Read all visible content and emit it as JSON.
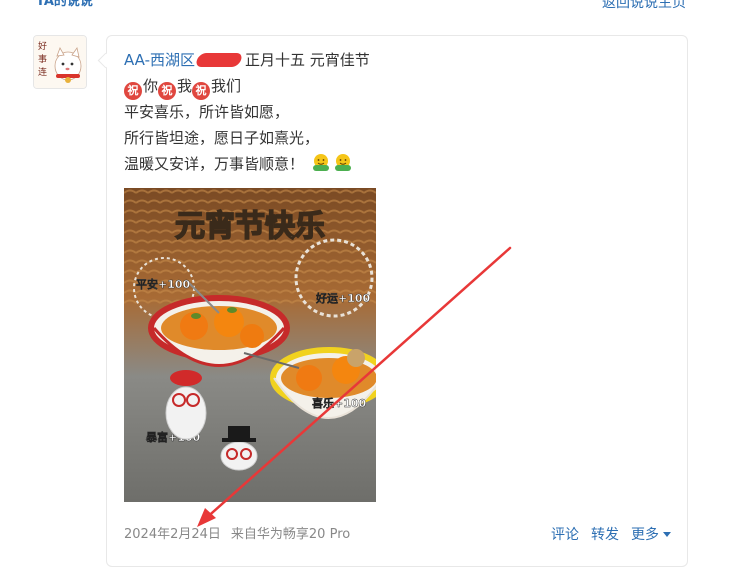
{
  "page": {
    "section_title": "TA的说说",
    "back_link": "返回说说主页"
  },
  "post": {
    "author": "AA-西湖区",
    "header_rest": "正月十五 元宵佳节",
    "greeting_badge": "祝",
    "greeting_words": [
      "你",
      "我",
      "我们"
    ],
    "lines": [
      "平安喜乐，所许皆如愿，",
      "所行皆坦途，愿日子如熹光，",
      "温暖又安详，万事皆顺意！"
    ],
    "image": {
      "title": "元宵节快乐",
      "labels": [
        "平安+100",
        "好运+100",
        "喜乐+100",
        "暴富+100"
      ]
    },
    "date": "2024年2月24日",
    "source": "来自华为畅享20 Pro",
    "actions": {
      "comment": "评论",
      "forward": "转发",
      "more": "更多"
    }
  },
  "colors": {
    "link": "#2d6fb3",
    "badge": "#e0473f",
    "annotation": "#e83838"
  }
}
